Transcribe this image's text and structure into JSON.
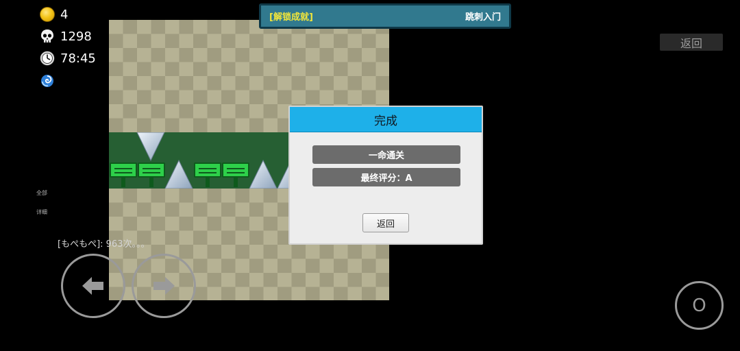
{
  "hud": {
    "coins": "4",
    "deaths": "1298",
    "time": "78:45"
  },
  "achievement": {
    "tag": "[解锁成就]",
    "name": "跳刺入门"
  },
  "top_back_label": "返回",
  "dialog": {
    "title": "完成",
    "result1": "一命通关",
    "result2": "最终评分：A",
    "back_label": "返回"
  },
  "side": {
    "all_label": "全部",
    "detail_label": "详细"
  },
  "chat": {
    "message": "[もぺもぺ]: 963次。。。"
  },
  "controls": {
    "action_label": "O"
  },
  "colors": {
    "banner_bg": "#31798e",
    "banner_tag": "#f2e63a",
    "dialog_title_bg": "#1eb0e9",
    "corridor": "#265f33",
    "sign": "#2ed04a"
  },
  "icons": [
    "coin-icon",
    "skull-icon",
    "clock-icon",
    "swirl-icon",
    "left-arrow-icon",
    "right-arrow-icon"
  ]
}
